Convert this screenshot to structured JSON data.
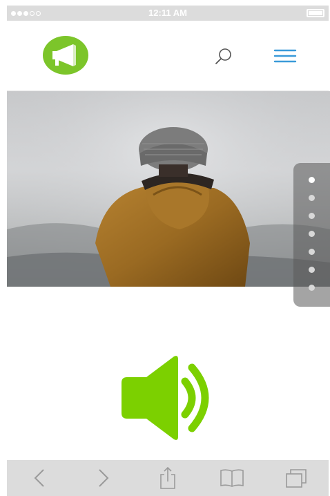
{
  "status_bar": {
    "signal_dots_filled": 3,
    "signal_dots_total": 5,
    "time": "12:11 AM",
    "battery": "battery-icon"
  },
  "header": {
    "logo_icon": "megaphone-icon",
    "search_icon": "search-icon",
    "menu_icon": "hamburger-menu-icon",
    "brand_color": "#7cc52a",
    "accent_color": "#3a9ad9"
  },
  "hero": {
    "image": "person-in-beanie-and-jacket-photo",
    "pager": {
      "count": 7,
      "active_index": 0
    }
  },
  "content": {
    "speaker_icon": "speaker-volume-icon",
    "speaker_color": "#7cd000"
  },
  "toolbar": {
    "items": [
      "back-icon",
      "forward-icon",
      "share-icon",
      "bookmarks-icon",
      "tabs-icon"
    ]
  }
}
